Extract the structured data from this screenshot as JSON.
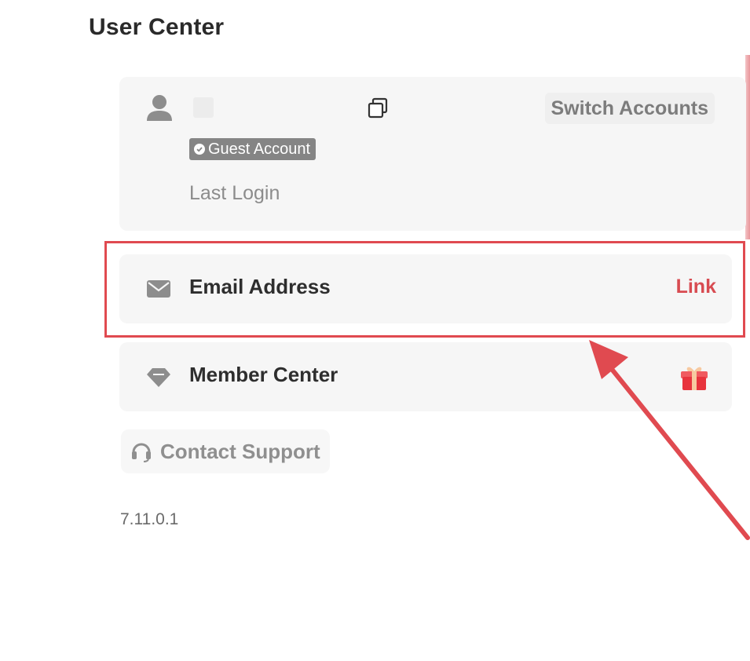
{
  "header": {
    "title": "User Center"
  },
  "account": {
    "switch_label": "Switch Accounts",
    "badge_label": "Guest Account",
    "last_login_label": "Last Login"
  },
  "rows": {
    "email": {
      "label": "Email Address",
      "action": "Link"
    },
    "member": {
      "label": "Member Center"
    }
  },
  "support": {
    "label": "Contact Support"
  },
  "version": "7.11.0.1",
  "icons": {
    "avatar": "user-icon",
    "copy": "copy-icon",
    "badge": "check-circle-icon",
    "email": "mail-icon",
    "member": "diamond-icon",
    "gift": "gift-icon",
    "support": "headset-icon"
  },
  "colors": {
    "accent_red": "#d84b51",
    "annotation_red": "#e04a50",
    "card_bg": "#f6f6f6",
    "badge_bg": "#858585"
  }
}
